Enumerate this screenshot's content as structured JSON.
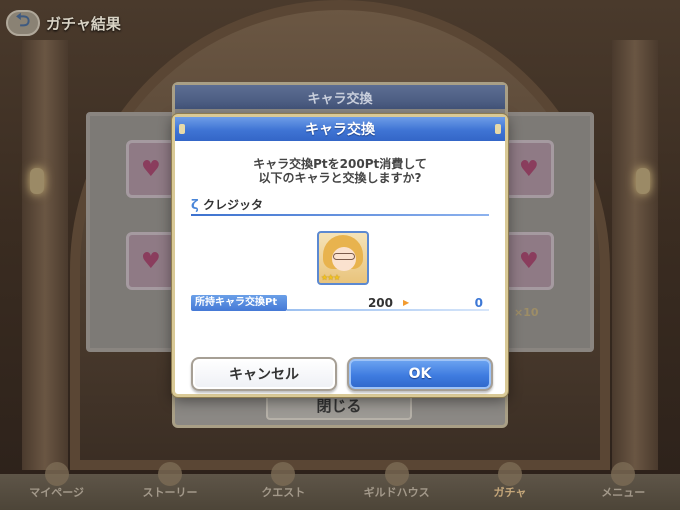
{
  "header": {
    "back_icon": "back-arrow-icon",
    "title": "ガチャ結果"
  },
  "background": {
    "dialog_title": "キャラ交換",
    "close_label": "閉じる",
    "bonus_text": "×10"
  },
  "dialog": {
    "title": "キャラ交換",
    "message_line1": "キャラ交換Ptを200Pt消費して",
    "message_line2": "以下のキャラと交換しますか?",
    "character_icon": "character-mark-icon",
    "character_name": "クレジッタ",
    "character_rarity": "★★★",
    "points_label": "所持キャラ交換Pt",
    "points_current": "200",
    "points_after": "0",
    "cancel_label": "キャンセル",
    "ok_label": "OK"
  },
  "bottom_nav": {
    "items": [
      {
        "label": "マイページ"
      },
      {
        "label": "ストーリー"
      },
      {
        "label": "クエスト"
      },
      {
        "label": "ギルドハウス"
      },
      {
        "label": "ガチャ"
      },
      {
        "label": "メニュー"
      }
    ]
  },
  "colors": {
    "accent_blue": "#3f74d4",
    "frame_gold": "#d9c996",
    "points_after_blue": "#3d78d6",
    "arrow_orange": "#f29a2e"
  }
}
